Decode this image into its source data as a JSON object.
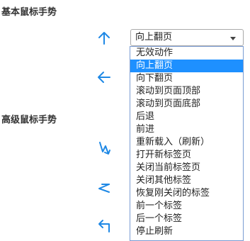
{
  "sections": {
    "basic_title": "基本鼠标手势",
    "advanced_title": "高级鼠标手势"
  },
  "gestures": [
    {
      "icon": "arrow-up-icon"
    },
    {
      "icon": "arrow-left-icon"
    },
    {
      "icon": "arrow-down-right-up-icon"
    },
    {
      "icon": "arrow-left-right-left-icon"
    },
    {
      "icon": "arrow-up-left-icon"
    }
  ],
  "select": {
    "value": "向上翻页",
    "options": [
      "无效动作",
      "向上翻页",
      "向下翻页",
      "滚动到页面顶部",
      "滚动到页面底部",
      "后退",
      "前进",
      "重新载入（刷新）",
      "打开新标签页",
      "关闭当前标签页",
      "关闭其他标签",
      "恢复刚关闭的标签",
      "前一个标签",
      "后一个标签",
      "停止刷新"
    ],
    "selected_index": 1
  },
  "colors": {
    "accent": "#1e90ff",
    "arrow": "#1e88e5"
  }
}
